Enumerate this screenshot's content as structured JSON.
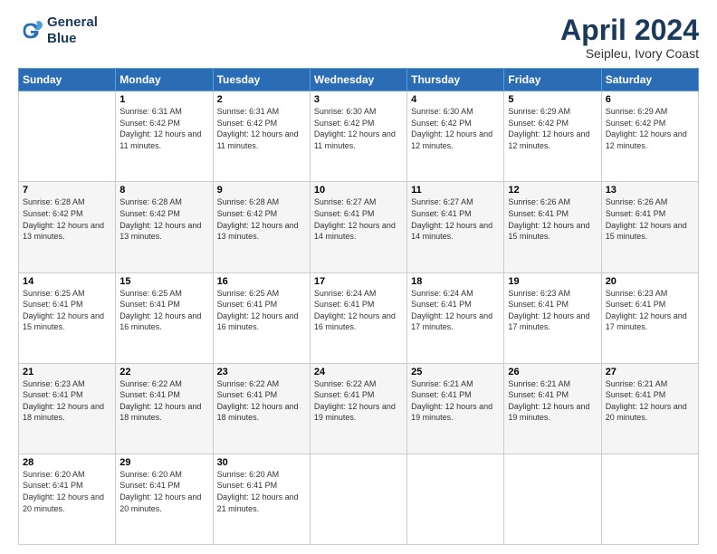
{
  "logo": {
    "line1": "General",
    "line2": "Blue"
  },
  "title": "April 2024",
  "location": "Seipleu, Ivory Coast",
  "days_header": [
    "Sunday",
    "Monday",
    "Tuesday",
    "Wednesday",
    "Thursday",
    "Friday",
    "Saturday"
  ],
  "weeks": [
    [
      {
        "day": "",
        "sunrise": "",
        "sunset": "",
        "daylight": ""
      },
      {
        "day": "1",
        "sunrise": "Sunrise: 6:31 AM",
        "sunset": "Sunset: 6:42 PM",
        "daylight": "Daylight: 12 hours and 11 minutes."
      },
      {
        "day": "2",
        "sunrise": "Sunrise: 6:31 AM",
        "sunset": "Sunset: 6:42 PM",
        "daylight": "Daylight: 12 hours and 11 minutes."
      },
      {
        "day": "3",
        "sunrise": "Sunrise: 6:30 AM",
        "sunset": "Sunset: 6:42 PM",
        "daylight": "Daylight: 12 hours and 11 minutes."
      },
      {
        "day": "4",
        "sunrise": "Sunrise: 6:30 AM",
        "sunset": "Sunset: 6:42 PM",
        "daylight": "Daylight: 12 hours and 12 minutes."
      },
      {
        "day": "5",
        "sunrise": "Sunrise: 6:29 AM",
        "sunset": "Sunset: 6:42 PM",
        "daylight": "Daylight: 12 hours and 12 minutes."
      },
      {
        "day": "6",
        "sunrise": "Sunrise: 6:29 AM",
        "sunset": "Sunset: 6:42 PM",
        "daylight": "Daylight: 12 hours and 12 minutes."
      }
    ],
    [
      {
        "day": "7",
        "sunrise": "Sunrise: 6:28 AM",
        "sunset": "Sunset: 6:42 PM",
        "daylight": "Daylight: 12 hours and 13 minutes."
      },
      {
        "day": "8",
        "sunrise": "Sunrise: 6:28 AM",
        "sunset": "Sunset: 6:42 PM",
        "daylight": "Daylight: 12 hours and 13 minutes."
      },
      {
        "day": "9",
        "sunrise": "Sunrise: 6:28 AM",
        "sunset": "Sunset: 6:42 PM",
        "daylight": "Daylight: 12 hours and 13 minutes."
      },
      {
        "day": "10",
        "sunrise": "Sunrise: 6:27 AM",
        "sunset": "Sunset: 6:41 PM",
        "daylight": "Daylight: 12 hours and 14 minutes."
      },
      {
        "day": "11",
        "sunrise": "Sunrise: 6:27 AM",
        "sunset": "Sunset: 6:41 PM",
        "daylight": "Daylight: 12 hours and 14 minutes."
      },
      {
        "day": "12",
        "sunrise": "Sunrise: 6:26 AM",
        "sunset": "Sunset: 6:41 PM",
        "daylight": "Daylight: 12 hours and 15 minutes."
      },
      {
        "day": "13",
        "sunrise": "Sunrise: 6:26 AM",
        "sunset": "Sunset: 6:41 PM",
        "daylight": "Daylight: 12 hours and 15 minutes."
      }
    ],
    [
      {
        "day": "14",
        "sunrise": "Sunrise: 6:25 AM",
        "sunset": "Sunset: 6:41 PM",
        "daylight": "Daylight: 12 hours and 15 minutes."
      },
      {
        "day": "15",
        "sunrise": "Sunrise: 6:25 AM",
        "sunset": "Sunset: 6:41 PM",
        "daylight": "Daylight: 12 hours and 16 minutes."
      },
      {
        "day": "16",
        "sunrise": "Sunrise: 6:25 AM",
        "sunset": "Sunset: 6:41 PM",
        "daylight": "Daylight: 12 hours and 16 minutes."
      },
      {
        "day": "17",
        "sunrise": "Sunrise: 6:24 AM",
        "sunset": "Sunset: 6:41 PM",
        "daylight": "Daylight: 12 hours and 16 minutes."
      },
      {
        "day": "18",
        "sunrise": "Sunrise: 6:24 AM",
        "sunset": "Sunset: 6:41 PM",
        "daylight": "Daylight: 12 hours and 17 minutes."
      },
      {
        "day": "19",
        "sunrise": "Sunrise: 6:23 AM",
        "sunset": "Sunset: 6:41 PM",
        "daylight": "Daylight: 12 hours and 17 minutes."
      },
      {
        "day": "20",
        "sunrise": "Sunrise: 6:23 AM",
        "sunset": "Sunset: 6:41 PM",
        "daylight": "Daylight: 12 hours and 17 minutes."
      }
    ],
    [
      {
        "day": "21",
        "sunrise": "Sunrise: 6:23 AM",
        "sunset": "Sunset: 6:41 PM",
        "daylight": "Daylight: 12 hours and 18 minutes."
      },
      {
        "day": "22",
        "sunrise": "Sunrise: 6:22 AM",
        "sunset": "Sunset: 6:41 PM",
        "daylight": "Daylight: 12 hours and 18 minutes."
      },
      {
        "day": "23",
        "sunrise": "Sunrise: 6:22 AM",
        "sunset": "Sunset: 6:41 PM",
        "daylight": "Daylight: 12 hours and 18 minutes."
      },
      {
        "day": "24",
        "sunrise": "Sunrise: 6:22 AM",
        "sunset": "Sunset: 6:41 PM",
        "daylight": "Daylight: 12 hours and 19 minutes."
      },
      {
        "day": "25",
        "sunrise": "Sunrise: 6:21 AM",
        "sunset": "Sunset: 6:41 PM",
        "daylight": "Daylight: 12 hours and 19 minutes."
      },
      {
        "day": "26",
        "sunrise": "Sunrise: 6:21 AM",
        "sunset": "Sunset: 6:41 PM",
        "daylight": "Daylight: 12 hours and 19 minutes."
      },
      {
        "day": "27",
        "sunrise": "Sunrise: 6:21 AM",
        "sunset": "Sunset: 6:41 PM",
        "daylight": "Daylight: 12 hours and 20 minutes."
      }
    ],
    [
      {
        "day": "28",
        "sunrise": "Sunrise: 6:20 AM",
        "sunset": "Sunset: 6:41 PM",
        "daylight": "Daylight: 12 hours and 20 minutes."
      },
      {
        "day": "29",
        "sunrise": "Sunrise: 6:20 AM",
        "sunset": "Sunset: 6:41 PM",
        "daylight": "Daylight: 12 hours and 20 minutes."
      },
      {
        "day": "30",
        "sunrise": "Sunrise: 6:20 AM",
        "sunset": "Sunset: 6:41 PM",
        "daylight": "Daylight: 12 hours and 21 minutes."
      },
      {
        "day": "",
        "sunrise": "",
        "sunset": "",
        "daylight": ""
      },
      {
        "day": "",
        "sunrise": "",
        "sunset": "",
        "daylight": ""
      },
      {
        "day": "",
        "sunrise": "",
        "sunset": "",
        "daylight": ""
      },
      {
        "day": "",
        "sunrise": "",
        "sunset": "",
        "daylight": ""
      }
    ]
  ]
}
